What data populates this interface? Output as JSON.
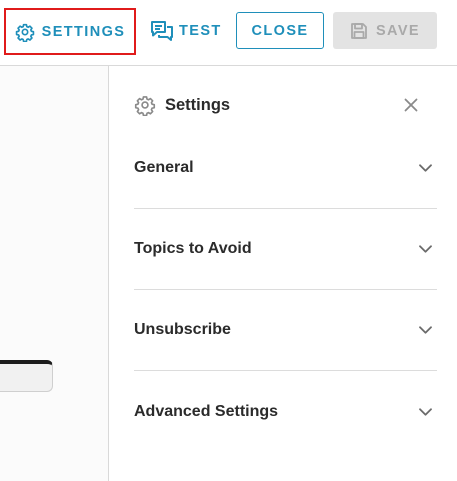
{
  "toolbar": {
    "settings_label": "SETTINGS",
    "test_label": "TEST",
    "close_label": "CLOSE",
    "save_label": "SAVE"
  },
  "panel": {
    "title": "Settings",
    "sections": [
      {
        "label": "General"
      },
      {
        "label": "Topics to Avoid"
      },
      {
        "label": "Unsubscribe"
      },
      {
        "label": "Advanced Settings"
      }
    ]
  },
  "colors": {
    "accent": "#1f8fba",
    "highlight_border": "#e01b1b",
    "disabled_bg": "#e3e3e3",
    "disabled_text": "#a9a9a9",
    "text": "#2b2b2b",
    "divider": "#dcdcdc"
  },
  "icons": {
    "settings_button": "gear-icon",
    "test_button": "chat-bubbles-icon",
    "save_button": "floppy-disk-icon",
    "panel_title": "gear-icon",
    "panel_close": "close-icon",
    "section_toggle": "chevron-down-icon"
  }
}
